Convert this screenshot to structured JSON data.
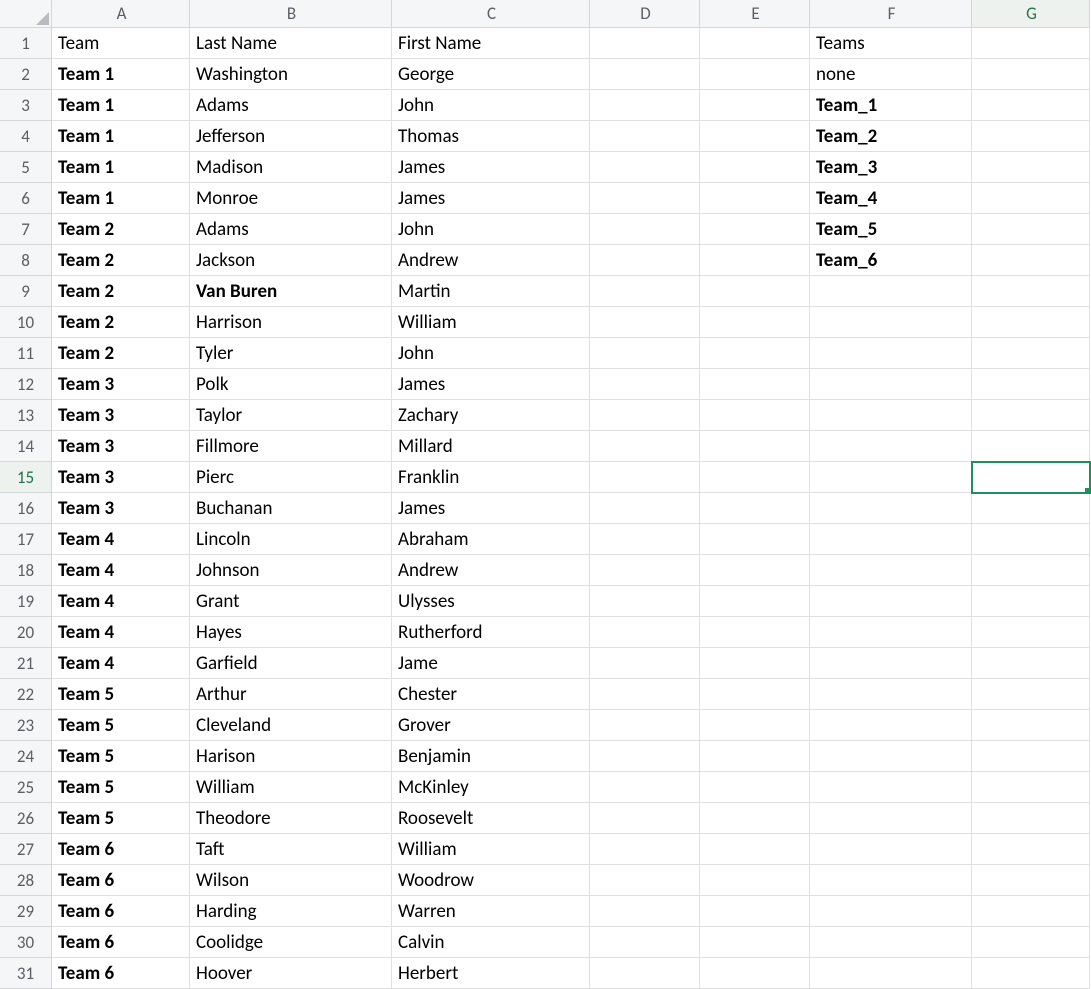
{
  "columns": [
    "A",
    "B",
    "C",
    "D",
    "E",
    "F",
    "G"
  ],
  "rowCount": 31,
  "selected": {
    "col": "G",
    "row": 15
  },
  "headers": {
    "A": "Team",
    "B": "Last Name",
    "C": "First Name",
    "F": "Teams"
  },
  "rows": [
    {
      "A": "Team 1",
      "B": "Washington",
      "C": "George",
      "F": "none"
    },
    {
      "A": "Team 1",
      "B": "Adams",
      "C": "John",
      "F": "Team_1",
      "Fbold": true
    },
    {
      "A": "Team 1",
      "B": "Jefferson",
      "C": "Thomas",
      "F": "Team_2",
      "Fbold": true
    },
    {
      "A": "Team 1",
      "B": "Madison",
      "C": "James",
      "F": "Team_3",
      "Fbold": true
    },
    {
      "A": "Team 1",
      "B": "Monroe",
      "C": "James",
      "F": "Team_4",
      "Fbold": true
    },
    {
      "A": "Team 2",
      "B": "Adams",
      "C": "John",
      "F": "Team_5",
      "Fbold": true
    },
    {
      "A": "Team 2",
      "B": "Jackson",
      "C": "Andrew",
      "F": "Team_6",
      "Fbold": true
    },
    {
      "A": "Team 2",
      "B": "Van Buren",
      "Bbold": true,
      "C": "Martin"
    },
    {
      "A": "Team 2",
      "B": "Harrison",
      "C": "William"
    },
    {
      "A": "Team 2",
      "B": "Tyler",
      "C": "John"
    },
    {
      "A": "Team 3",
      "B": "Polk",
      "C": "James"
    },
    {
      "A": "Team 3",
      "B": "Taylor",
      "C": "Zachary"
    },
    {
      "A": "Team 3",
      "B": "Fillmore",
      "C": "Millard"
    },
    {
      "A": "Team 3",
      "B": "Pierc",
      "C": "Franklin"
    },
    {
      "A": "Team 3",
      "B": "Buchanan",
      "C": "James"
    },
    {
      "A": "Team 4",
      "B": "Lincoln",
      "C": "Abraham"
    },
    {
      "A": "Team 4",
      "B": "Johnson",
      "C": "Andrew"
    },
    {
      "A": "Team 4",
      "B": "Grant",
      "C": "Ulysses"
    },
    {
      "A": "Team 4",
      "B": "Hayes",
      "C": "Rutherford"
    },
    {
      "A": "Team 4",
      "B": "Garfield",
      "C": "Jame"
    },
    {
      "A": "Team 5",
      "B": "Arthur",
      "C": "Chester"
    },
    {
      "A": "Team 5",
      "B": "Cleveland",
      "C": "Grover"
    },
    {
      "A": "Team 5",
      "B": "Harison",
      "C": "Benjamin"
    },
    {
      "A": "Team 5",
      "B": "William",
      "C": "McKinley"
    },
    {
      "A": "Team 5",
      "B": "Theodore",
      "C": "Roosevelt"
    },
    {
      "A": "Team 6",
      "B": "Taft",
      "C": "William"
    },
    {
      "A": "Team 6",
      "B": "Wilson",
      "C": "Woodrow"
    },
    {
      "A": "Team 6",
      "B": "Harding",
      "C": "Warren"
    },
    {
      "A": "Team 6",
      "B": "Coolidge",
      "C": "Calvin"
    },
    {
      "A": "Team 6",
      "B": "Hoover",
      "C": "Herbert"
    }
  ]
}
